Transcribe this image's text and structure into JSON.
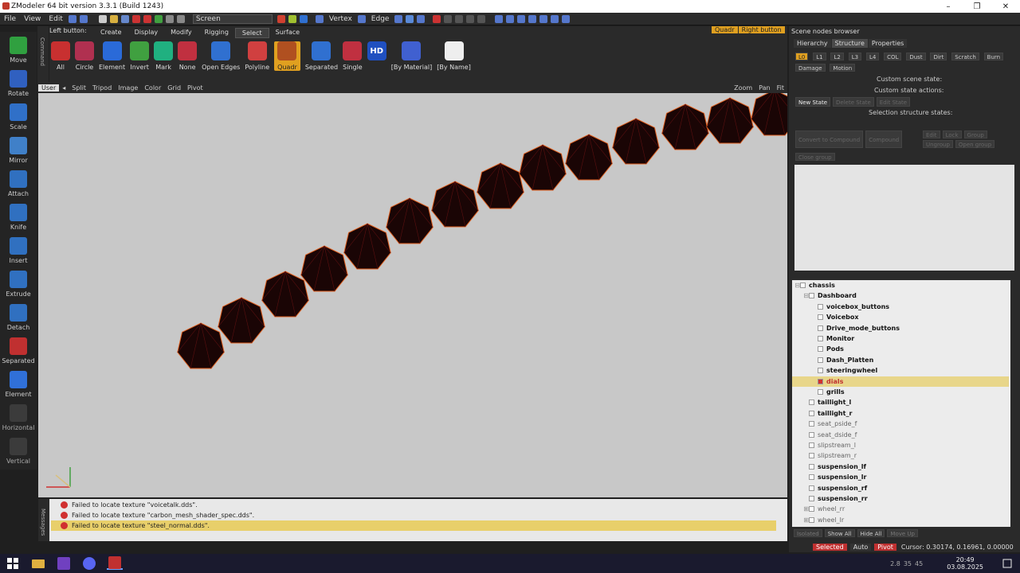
{
  "window": {
    "title": "ZModeler 64 bit version 3.3.1 (Build 1243)",
    "controls": [
      "–",
      "❐",
      "✕"
    ]
  },
  "menu": {
    "items": [
      "File",
      "View",
      "Edit"
    ],
    "space_dropdown": "Screen",
    "mode_vertex": "Vertex",
    "mode_edge": "Edge"
  },
  "left_tools": [
    "Move",
    "Rotate",
    "Scale",
    "Mirror",
    "Attach",
    "Knife",
    "Insert",
    "Extrude",
    "Detach",
    "Separated",
    "Element",
    "Horizontal",
    "Vertical"
  ],
  "command_strip_label": "Command",
  "ribbon": {
    "left_button_label": "Left button:",
    "tabs": [
      "Create",
      "Display",
      "Modify",
      "Rigging",
      "Select",
      "Surface"
    ],
    "active_tab": "Select",
    "buttons": [
      "All",
      "Circle",
      "Element",
      "Invert",
      "Mark",
      "None",
      "Open Edges",
      "Polyline",
      "Quadr",
      "Separated",
      "Single",
      "[By Material]",
      "[By Name]"
    ],
    "active_button": "Quadr"
  },
  "top_right_badges": [
    "Quadr",
    "Right button"
  ],
  "viewport": {
    "menu": [
      "User",
      "Split",
      "Tripod",
      "Image",
      "Color",
      "Grid",
      "Pivot"
    ],
    "right_controls": [
      "Zoom",
      "Pan",
      "Fit"
    ]
  },
  "messages": {
    "strip_label": "Messages",
    "items": [
      {
        "text": "Failed to locate texture \"voicetalk.dds\".",
        "selected": false
      },
      {
        "text": "Failed to locate texture \"carbon_mesh_shader_spec.dds\".",
        "selected": false
      },
      {
        "text": "Failed to locate texture \"steel_normal.dds\".",
        "selected": true
      }
    ]
  },
  "scene_browser": {
    "title": "Scene nodes browser",
    "tabs": [
      "Hierarchy",
      "Structure",
      "Properties"
    ],
    "active_tab": "Structure",
    "lod_chips": [
      "L0",
      "L1",
      "L2",
      "L3",
      "L4",
      "COL",
      "Dust",
      "Dirt",
      "Scratch",
      "Burn"
    ],
    "damage_dropdown": "Damage",
    "motion_dropdown": "Motion",
    "custom_scene_state": "Custom scene state:",
    "custom_state_actions": "Custom state actions:",
    "new_state_btn": "New State",
    "delete_state_btn": "Delete State",
    "edit_state_btn": "Edit State",
    "selection_structure_states": "Selection structure states:",
    "convert_to_compound": "Convert to Compound",
    "compound": "Compound",
    "edit_btn": "Edit",
    "lock_btn": "Lock",
    "group_btn": "Group",
    "ungroup_btn": "Ungroup",
    "open_group_btn": "Open group",
    "close_group_btn": "Close group"
  },
  "tree": [
    {
      "label": "chassis",
      "indent": 0,
      "dim": false,
      "selected": false,
      "expander": "⊟",
      "bold": false
    },
    {
      "label": "Dashboard",
      "indent": 1,
      "dim": false,
      "selected": false,
      "expander": "⊟",
      "bold": true
    },
    {
      "label": "voicebox_buttons",
      "indent": 2,
      "dim": false,
      "selected": false,
      "expander": "",
      "bold": true
    },
    {
      "label": "Voicebox",
      "indent": 2,
      "dim": false,
      "selected": false,
      "expander": "",
      "bold": true
    },
    {
      "label": "Drive_mode_buttons",
      "indent": 2,
      "dim": false,
      "selected": false,
      "expander": "",
      "bold": true
    },
    {
      "label": "Monitor",
      "indent": 2,
      "dim": false,
      "selected": false,
      "expander": "",
      "bold": true
    },
    {
      "label": "Pods",
      "indent": 2,
      "dim": false,
      "selected": false,
      "expander": "",
      "bold": true
    },
    {
      "label": "Dash_Platten",
      "indent": 2,
      "dim": false,
      "selected": false,
      "expander": "",
      "bold": true
    },
    {
      "label": "steeringwheel",
      "indent": 2,
      "dim": false,
      "selected": false,
      "expander": "",
      "bold": true
    },
    {
      "label": "dials",
      "indent": 2,
      "dim": false,
      "selected": true,
      "expander": "",
      "bold": true
    },
    {
      "label": "grills",
      "indent": 2,
      "dim": false,
      "selected": false,
      "expander": "",
      "bold": true
    },
    {
      "label": "taillight_l",
      "indent": 1,
      "dim": false,
      "selected": false,
      "expander": "",
      "bold": true
    },
    {
      "label": "taillight_r",
      "indent": 1,
      "dim": false,
      "selected": false,
      "expander": "",
      "bold": true
    },
    {
      "label": "seat_pside_f",
      "indent": 1,
      "dim": true,
      "selected": false,
      "expander": "",
      "bold": false
    },
    {
      "label": "seat_dside_f",
      "indent": 1,
      "dim": true,
      "selected": false,
      "expander": "",
      "bold": false
    },
    {
      "label": "slipstream_l",
      "indent": 1,
      "dim": true,
      "selected": false,
      "expander": "",
      "bold": false
    },
    {
      "label": "slipstream_r",
      "indent": 1,
      "dim": true,
      "selected": false,
      "expander": "",
      "bold": false
    },
    {
      "label": "suspension_lf",
      "indent": 1,
      "dim": false,
      "selected": false,
      "expander": "",
      "bold": true
    },
    {
      "label": "suspension_lr",
      "indent": 1,
      "dim": false,
      "selected": false,
      "expander": "",
      "bold": true
    },
    {
      "label": "suspension_rf",
      "indent": 1,
      "dim": false,
      "selected": false,
      "expander": "",
      "bold": true
    },
    {
      "label": "suspension_rr",
      "indent": 1,
      "dim": false,
      "selected": false,
      "expander": "",
      "bold": true
    },
    {
      "label": "wheel_rr",
      "indent": 1,
      "dim": true,
      "selected": false,
      "expander": "⊞",
      "bold": false
    },
    {
      "label": "wheel_lr",
      "indent": 1,
      "dim": true,
      "selected": false,
      "expander": "⊞",
      "bold": false
    }
  ],
  "tree_bottom": [
    "Isolated",
    "Show All",
    "Hide All",
    "Move Up"
  ],
  "status": {
    "selected": "Selected",
    "auto": "Auto",
    "pivot": "Pivot",
    "cursor": "Cursor: 0.30174, 0.16961, 0.00000"
  },
  "taskbar": {
    "time": "20:49",
    "date": "03.08.2025",
    "indicators": [
      "2.8",
      "35",
      "45"
    ]
  },
  "colors": {
    "accent": "#e0a020",
    "viewport_bg": "#c8c8c8",
    "mesh_fill": "#1a0505",
    "mesh_edge": "#e06020",
    "error": "#d03030"
  }
}
